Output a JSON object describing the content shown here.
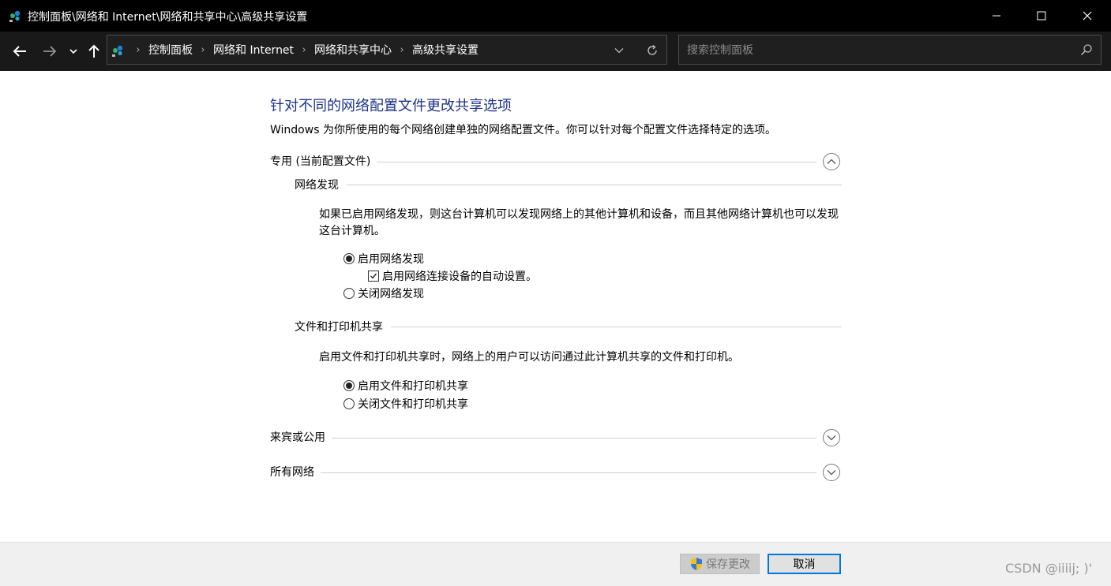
{
  "window": {
    "title": "控制面板\\网络和 Internet\\网络和共享中心\\高级共享设置"
  },
  "nav": {
    "breadcrumbs": [
      "控制面板",
      "网络和 Internet",
      "网络和共享中心",
      "高级共享设置"
    ],
    "search_placeholder": "搜索控制面板"
  },
  "content": {
    "heading": "针对不同的网络配置文件更改共享选项",
    "description": "Windows 为你所使用的每个网络创建单独的网络配置文件。你可以针对每个配置文件选择特定的选项。",
    "private_profile": {
      "label": "专用 (当前配置文件)",
      "expanded": true,
      "network_discovery": {
        "title": "网络发现",
        "description": "如果已启用网络发现，则这台计算机可以发现网络上的其他计算机和设备，而且其他网络计算机也可以发现这台计算机。",
        "options": [
          {
            "label": "启用网络发现",
            "selected": true
          },
          {
            "label": "关闭网络发现",
            "selected": false
          }
        ],
        "auto_setup_checkbox": {
          "label": "启用网络连接设备的自动设置。",
          "checked": true
        }
      },
      "file_printer_sharing": {
        "title": "文件和打印机共享",
        "description": "启用文件和打印机共享时，网络上的用户可以访问通过此计算机共享的文件和打印机。",
        "options": [
          {
            "label": "启用文件和打印机共享",
            "selected": true
          },
          {
            "label": "关闭文件和打印机共享",
            "selected": false
          }
        ]
      }
    },
    "guest_public_profile": {
      "label": "来宾或公用",
      "expanded": false
    },
    "all_networks_profile": {
      "label": "所有网络",
      "expanded": false
    }
  },
  "footer": {
    "save_label": "保存更改",
    "save_enabled": false,
    "cancel_label": "取消",
    "watermark": "CSDN @iiiij; )'"
  },
  "colors": {
    "heading": "#1e3287",
    "titlebar_bg": "#000000",
    "navbar_bg": "#191919",
    "focus_border": "#0078d7"
  },
  "icons": {
    "app": "network-globe-icon",
    "shield": "uac-shield-icon"
  }
}
